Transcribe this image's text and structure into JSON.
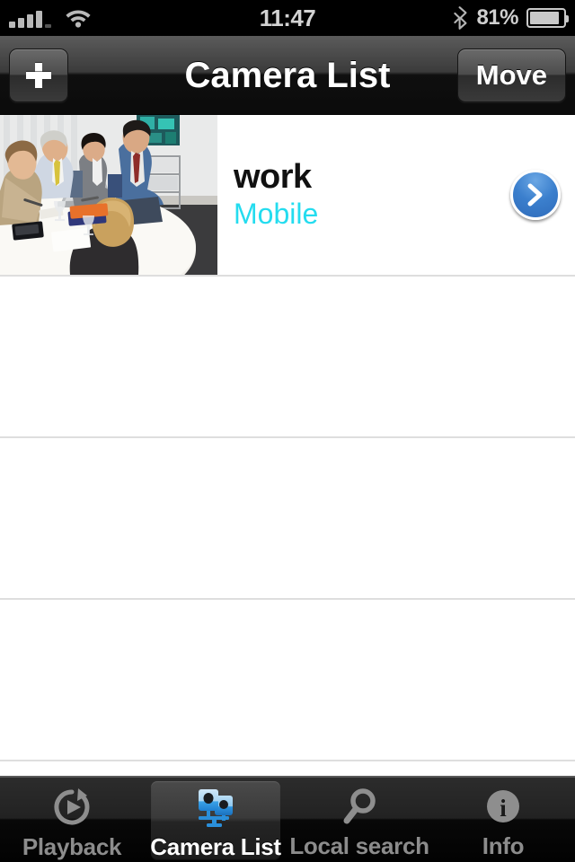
{
  "status_bar": {
    "signal_icon": "signal-bars-icon",
    "signal_bars_total": 5,
    "signal_bars_filled": 4,
    "wifi_icon": "wifi-icon",
    "time": "11:47",
    "bluetooth_icon": "bluetooth-icon",
    "battery_percent": "81%",
    "battery_level": 81,
    "battery_icon": "battery-icon"
  },
  "nav_bar": {
    "title": "Camera List",
    "add_button_icon": "plus-icon",
    "move_button_label": "Move"
  },
  "list": {
    "rows": [
      {
        "title": "work",
        "subtitle": "Mobile",
        "thumbnail_icon": "meeting-photo-thumbnail",
        "accessory_icon": "blue-disclosure-arrow-icon",
        "has_content": true
      },
      {
        "title": "",
        "subtitle": "",
        "has_content": false
      },
      {
        "title": "",
        "subtitle": "",
        "has_content": false
      },
      {
        "title": "",
        "subtitle": "",
        "has_content": false
      }
    ]
  },
  "tab_bar": {
    "selected_index": 1,
    "tabs": [
      {
        "label": "Playback",
        "icon": "playback-replay-icon"
      },
      {
        "label": "Camera List",
        "icon": "network-cameras-icon"
      },
      {
        "label": "Local search",
        "icon": "magnifying-glass-icon"
      },
      {
        "label": "Info",
        "icon": "info-circle-icon"
      }
    ]
  },
  "colors": {
    "accent_cyan": "#24dcef",
    "accent_blue": "#3b7fcd",
    "nav_bar_dark": "#1a1a1a",
    "tab_selected_text": "#ffffff",
    "tab_text": "#8c8c8c"
  }
}
